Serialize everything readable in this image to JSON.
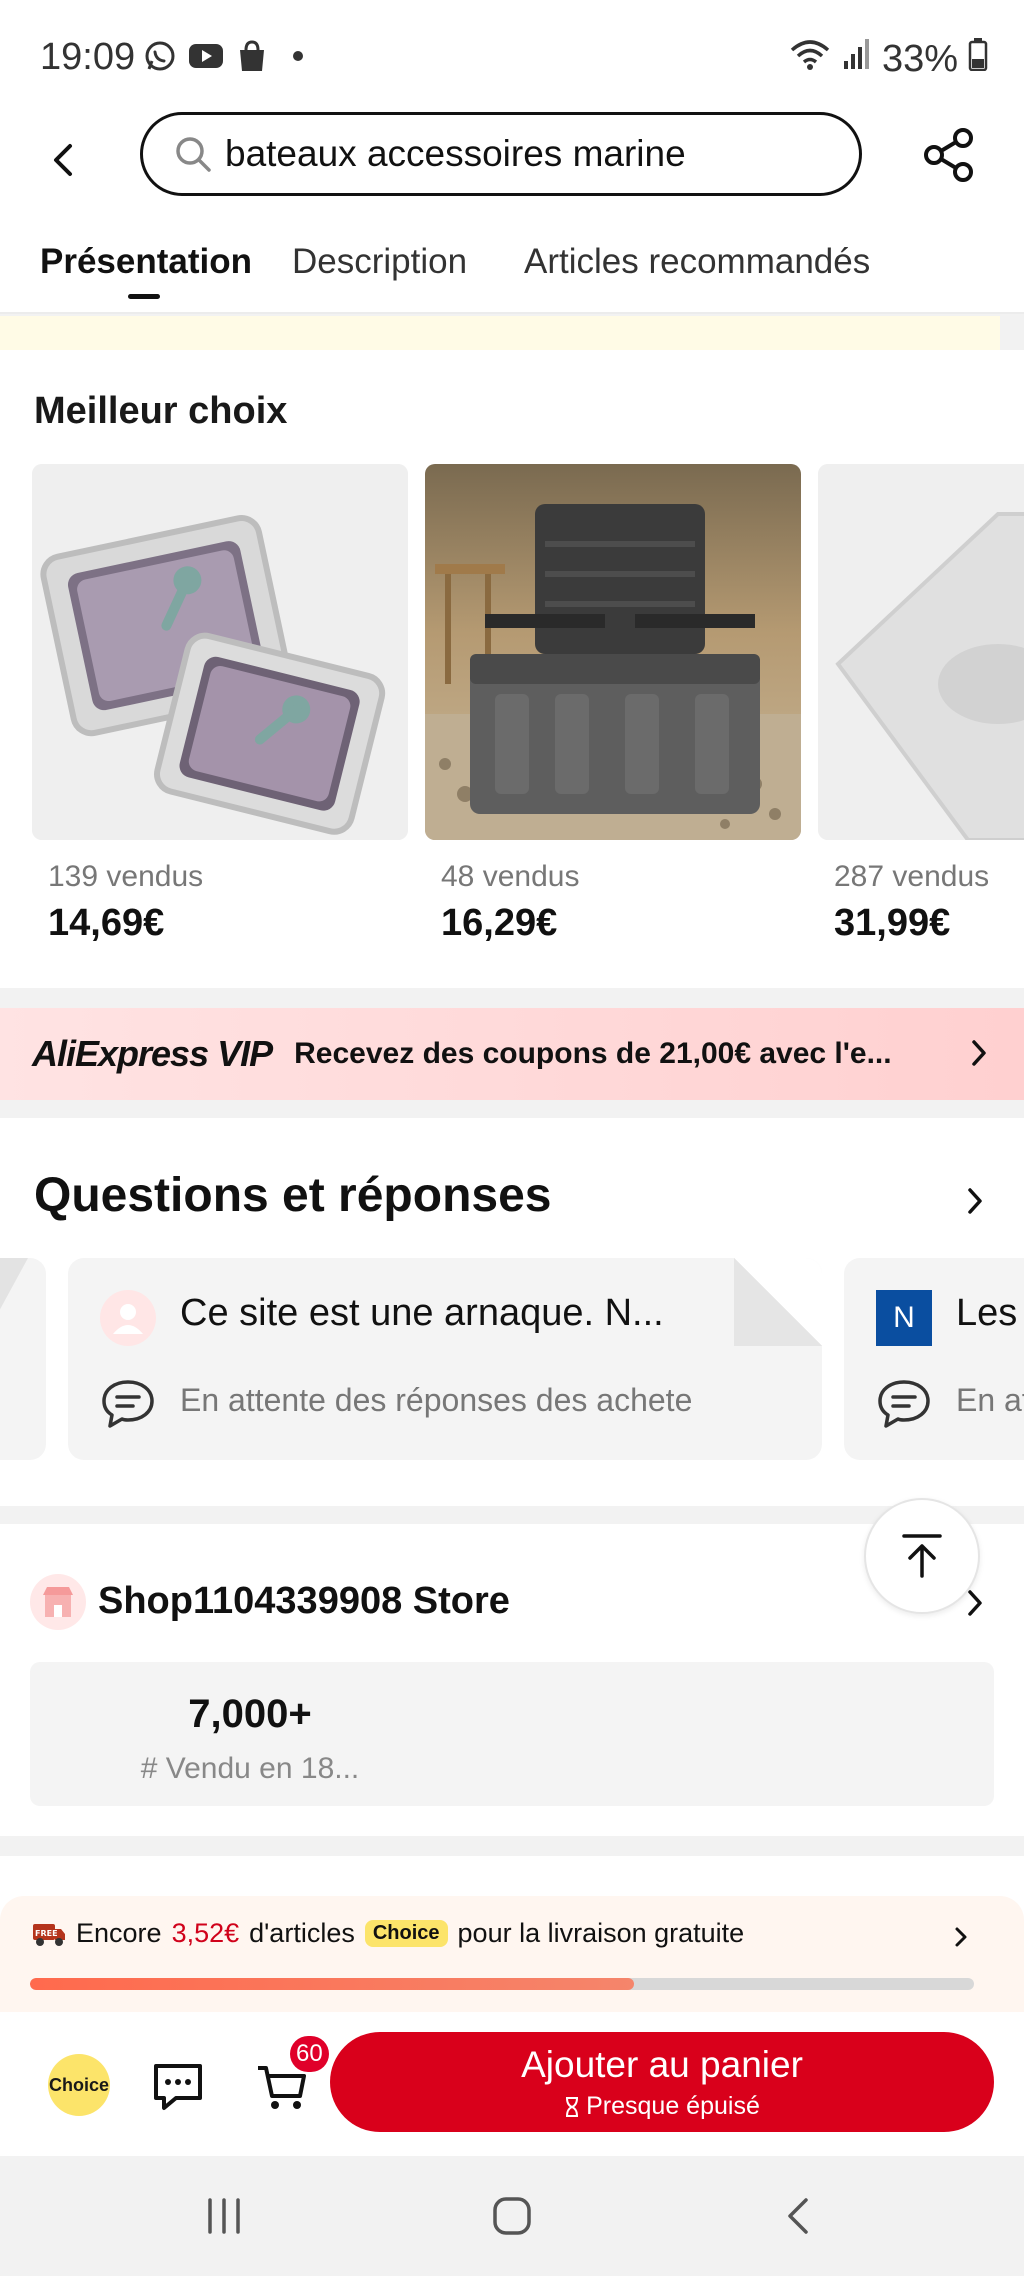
{
  "status_bar": {
    "time": "19:09",
    "battery": "33%"
  },
  "search": {
    "query": "bateaux accessoires marine"
  },
  "tabs": [
    {
      "label": "Présentation",
      "active": true
    },
    {
      "label": "Description",
      "active": false
    },
    {
      "label": "Articles recommandés",
      "active": false
    }
  ],
  "best_choice": {
    "title": "Meilleur choix",
    "products": [
      {
        "sold": "139 vendus",
        "price": "14,69€"
      },
      {
        "sold": "48 vendus",
        "price": "16,29€"
      },
      {
        "sold": "287 vendus",
        "price": "31,99€"
      }
    ]
  },
  "vip": {
    "brand": "AliExpress VIP",
    "text": "Recevez des coupons de 21,00€ avec l'e..."
  },
  "qa": {
    "title": "Questions et réponses",
    "cards": [
      {
        "question": "Ce site est une arnaque. N...",
        "answer": "En attente des réponses des achete"
      },
      {
        "badge": "N",
        "question": "Les",
        "answer": "En at"
      }
    ]
  },
  "store": {
    "name": "Shop1104339908 Store",
    "stat_value": "7,000+",
    "stat_label": "# Vendu en 18..."
  },
  "shipping": {
    "prefix": "Encore",
    "amount": "3,52€",
    "middle": "d'articles",
    "chip": "Choice",
    "suffix": "pour la livraison gratuite",
    "progress": 0.64
  },
  "action_bar": {
    "choice_label": "Choice",
    "cart_count": "60",
    "add_to_cart": "Ajouter au panier",
    "stock_note": "Presque épuisé"
  },
  "colors": {
    "accent": "#d9001b",
    "choice_yellow": "#fce46a"
  }
}
